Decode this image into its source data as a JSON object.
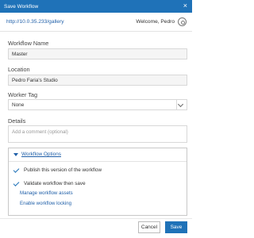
{
  "dialog": {
    "title": "Save Workflow",
    "close_glyph": "×"
  },
  "server": {
    "url": "http://10.0.35.233/gallery",
    "welcome": "Welcome, Pedro"
  },
  "form": {
    "workflow_name_label": "Workflow Name",
    "workflow_name_value": "Master",
    "location_label": "Location",
    "location_value": "Pedro Faria's Studio",
    "worker_tag_label": "Worker Tag",
    "worker_tag_value": "None",
    "details_label": "Details",
    "details_placeholder": "Add a comment (optional)"
  },
  "options": {
    "header": "Workflow Options",
    "publish_label": "Publish this version of the workflow",
    "validate_label": "Validate workflow then save",
    "manage_assets_link": "Manage workflow assets",
    "enable_locking_link": "Enable workflow locking"
  },
  "buttons": {
    "cancel": "Cancel",
    "save": "Save"
  },
  "colors": {
    "accent": "#1f72b8",
    "link": "#1f5fa8"
  }
}
